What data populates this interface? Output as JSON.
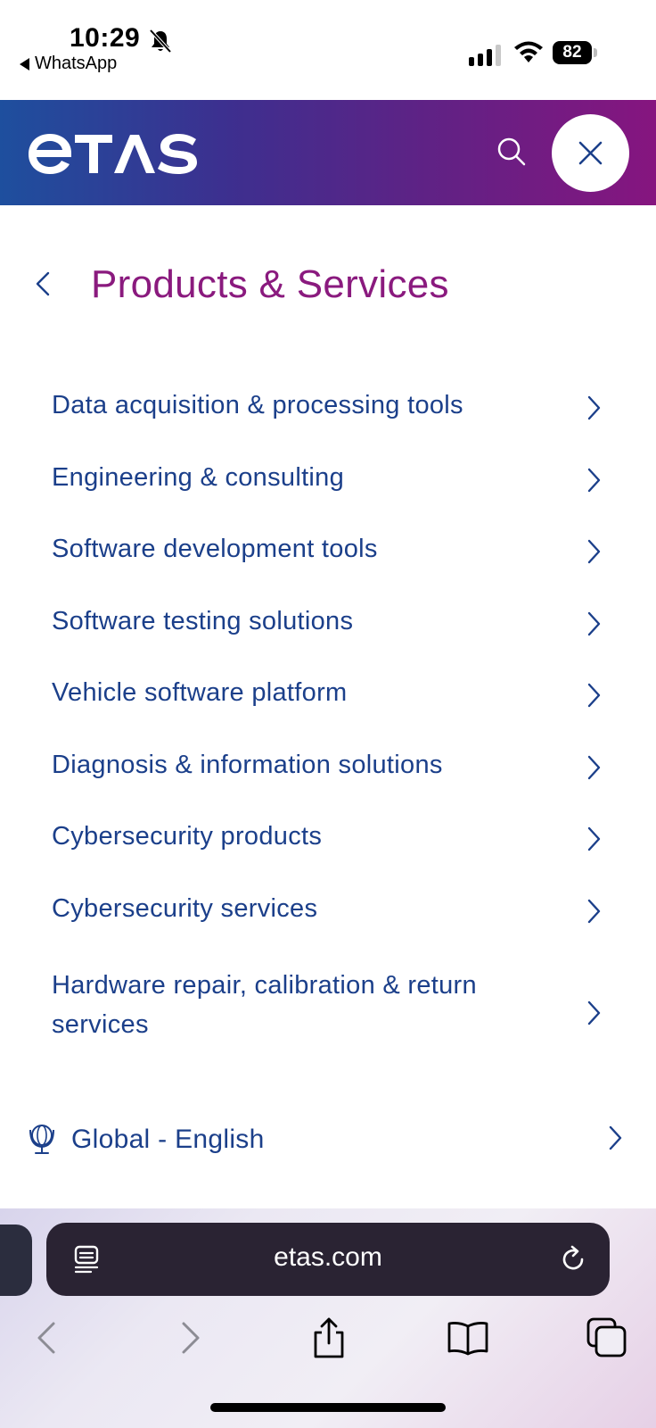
{
  "status": {
    "time": "10:29",
    "back_app": "WhatsApp",
    "battery": "82"
  },
  "header": {
    "logo_text": "etas",
    "brand_color": "#86157f",
    "accent_color": "#1b3f8a"
  },
  "panel": {
    "title": "Products & Services",
    "items": [
      {
        "label": "Data acquisition & processing tools"
      },
      {
        "label": "Engineering & consulting"
      },
      {
        "label": "Software development tools"
      },
      {
        "label": "Software testing solutions"
      },
      {
        "label": "Vehicle software platform"
      },
      {
        "label": "Diagnosis & information solutions"
      },
      {
        "label": "Cybersecurity products"
      },
      {
        "label": "Cybersecurity services"
      },
      {
        "label": "Hardware repair, calibration & return services"
      }
    ]
  },
  "language": {
    "label": "Global - English"
  },
  "browser": {
    "url": "etas.com"
  },
  "icons": [
    "bell-slash-icon",
    "signal-icon",
    "wifi-icon",
    "battery-icon",
    "search-icon",
    "close-icon",
    "chevron-left-icon",
    "chevron-right-icon",
    "globe-icon",
    "reader-icon",
    "reload-icon",
    "share-icon",
    "bookmarks-icon",
    "tabs-icon"
  ]
}
